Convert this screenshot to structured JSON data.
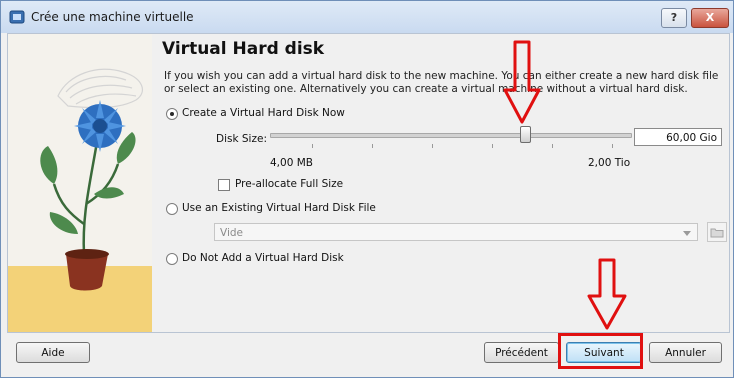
{
  "window": {
    "title": "Crée une machine virtuelle",
    "help_button": "?",
    "close_button": "X"
  },
  "page": {
    "heading": "Virtual Hard disk",
    "description": "If you wish you can add a virtual hard disk to the new machine. You can either create a new hard disk file or select an existing one. Alternatively you can create a virtual machine without a virtual hard disk."
  },
  "options": {
    "create_now": {
      "label": "Create a Virtual Hard Disk Now",
      "selected": true
    },
    "disk_size_label": "Disk Size:",
    "disk_size_value": "60,00 Gio",
    "slider_min": "4,00 MB",
    "slider_max": "2,00 Tio",
    "preallocate": {
      "label": "Pre-allocate Full Size",
      "checked": false
    },
    "use_existing": {
      "label": "Use an Existing Virtual Hard Disk File",
      "selected": false
    },
    "existing_combo_value": "Vide",
    "no_disk": {
      "label": "Do Not Add a Virtual Hard Disk",
      "selected": false
    }
  },
  "buttons": {
    "help": "Aide",
    "back": "Précédent",
    "next": "Suivant",
    "cancel": "Annuler"
  },
  "annotations": {
    "highlight_color": "#e01010"
  }
}
